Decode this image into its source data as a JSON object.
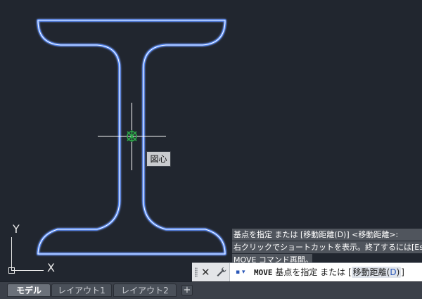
{
  "drawing": {
    "snap_tooltip": "図心",
    "ucs_y_label": "Y",
    "ucs_x_label": "X"
  },
  "command_history": [
    "基点を指定 または [移動距離(D)] <移動距離>:",
    "右クリックでショートカットを表示。終了するには[Esc]",
    "MOVE コマンド再開。"
  ],
  "command_line": {
    "keyword": "MOVE",
    "prompt": "基点を指定 または [",
    "option_label": "移動距離(",
    "option_key": "D",
    "option_close": ")",
    "end": "]",
    "close_icon": "close-icon",
    "settings_icon": "wrench-icon",
    "recent_icon": "recent-commands-icon"
  },
  "layout_tabs": [
    {
      "label": "モデル",
      "active": true
    },
    {
      "label": "レイアウト1",
      "active": false
    },
    {
      "label": "レイアウト2",
      "active": false
    }
  ],
  "add_tab_label": "+",
  "colors": {
    "background": "#21262f",
    "selection_glow": "#4a86ff",
    "snap_marker": "#2ea84a",
    "crosshair": "#ffffff"
  }
}
